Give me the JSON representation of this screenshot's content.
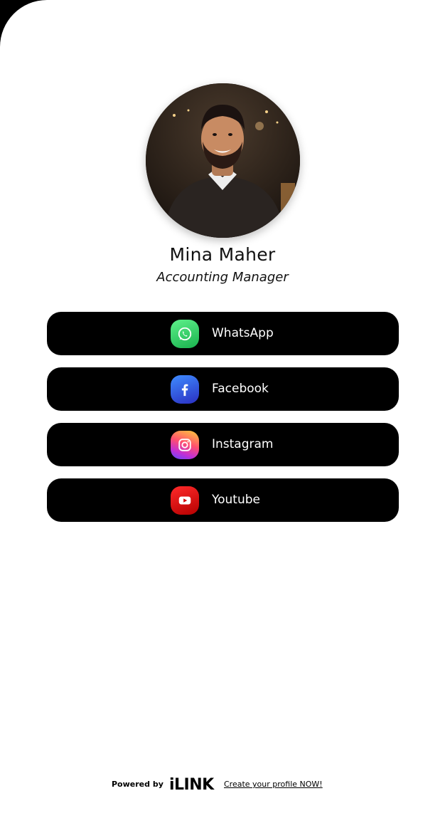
{
  "profile": {
    "name": "Mina Maher",
    "title": "Accounting Manager"
  },
  "links": [
    {
      "label": "WhatsApp",
      "icon": "whatsapp-icon",
      "color": "#25D366"
    },
    {
      "label": "Facebook",
      "icon": "facebook-icon",
      "color": "#1877F2"
    },
    {
      "label": "Instagram",
      "icon": "instagram-icon",
      "color": "#E1306C"
    },
    {
      "label": "Youtube",
      "icon": "youtube-icon",
      "color": "#E00000"
    }
  ],
  "footer": {
    "powered_by": "Powered by",
    "brand": "iLINK",
    "cta": "Create your profile NOW!"
  },
  "colors": {
    "background": "#FFFFFF",
    "button": "#000000",
    "button_text": "#FFFFFF"
  }
}
